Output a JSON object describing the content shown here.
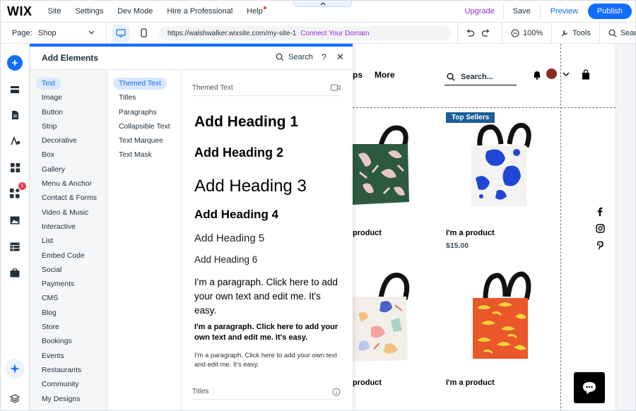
{
  "topbar": {
    "logo": "WIX",
    "menu": [
      "Site",
      "Settings",
      "Dev Mode",
      "Hire a Professional",
      "Help"
    ],
    "handle_icon": "chevron-up",
    "upgrade": "Upgrade",
    "save": "Save",
    "preview": "Preview",
    "publish": "Publish"
  },
  "secbar": {
    "page_label": "Page:",
    "page_value": "Shop",
    "url": "https://walshwalker.wixsite.com/my-site-1",
    "connect": "Connect Your Domain",
    "zoom": "100%",
    "tools": "Tools",
    "search": "Search"
  },
  "rail": {
    "badge": "1"
  },
  "panel": {
    "title": "Add Elements",
    "search": "Search",
    "help": "?",
    "close": "✕",
    "categories": [
      "Text",
      "Image",
      "Button",
      "Strip",
      "Decorative",
      "Box",
      "Gallery",
      "Menu & Anchor",
      "Contact & Forms",
      "Video & Music",
      "Interactive",
      "List",
      "Embed Code",
      "Social",
      "Payments",
      "CMS",
      "Blog",
      "Store",
      "Bookings",
      "Events",
      "Restaurants",
      "Community",
      "My Designs"
    ],
    "subcategories": [
      "Themed Text",
      "Titles",
      "Paragraphs",
      "Collapsible Text",
      "Text Marquee",
      "Text Mask"
    ],
    "section_themed": "Themed Text",
    "headings": [
      "Add Heading 1",
      "Add Heading 2",
      "Add Heading 3",
      "Add Heading 4",
      "Add Heading 5",
      "Add Heading 6"
    ],
    "paragraph1": "I'm a paragraph. Click here to add your own text and edit me. It's easy.",
    "paragraph2": "I'm a paragraph. Click here to add your own text and edit me. It's easy.",
    "paragraph3": "I'm a paragraph. Click here to add your own text and edit me. It's easy.",
    "section_titles": "Titles"
  },
  "site": {
    "nav_partial": "ps",
    "nav_more": "More",
    "search_placeholder": "Search...",
    "top_sellers": "Top Sellers",
    "products": [
      {
        "name": "product",
        "price": ""
      },
      {
        "name": "I'm a product",
        "price": "$15.00"
      },
      {
        "name": "product",
        "price": ""
      },
      {
        "name": "I'm a product",
        "price": ""
      }
    ]
  },
  "colors": {
    "accent": "#116dff",
    "upgrade": "#9a27d5",
    "badge_blue": "#1c5e96",
    "notification": "#e3414f"
  }
}
